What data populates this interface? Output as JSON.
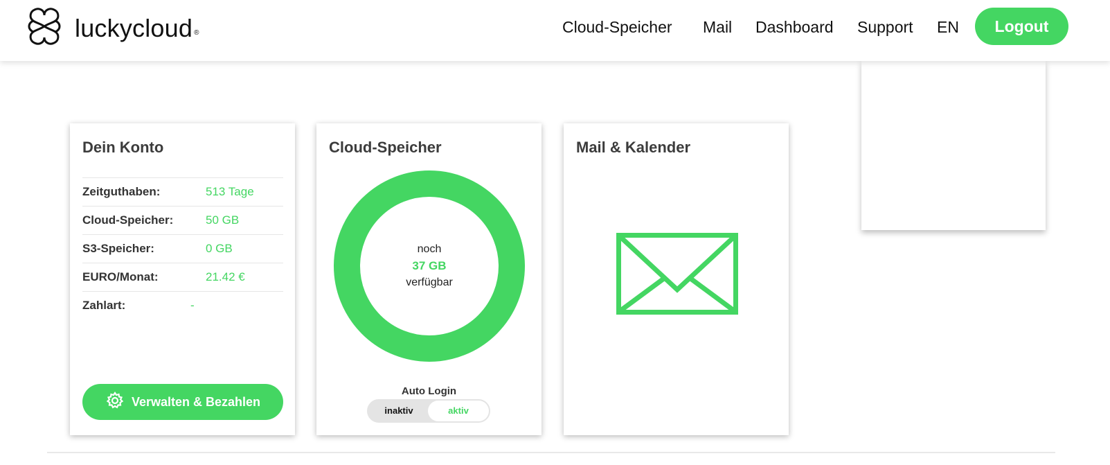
{
  "brand": {
    "name": "luckycloud",
    "reg": "®"
  },
  "nav": {
    "items": [
      "Cloud-Speicher",
      "Mail",
      "Dashboard",
      "Support",
      "EN"
    ],
    "logout_label": "Logout"
  },
  "account_card": {
    "title": "Dein Konto",
    "rows": [
      {
        "label": "Zeitguthaben:",
        "value": "513 Tage"
      },
      {
        "label": "Cloud-Speicher:",
        "value": "50 GB"
      },
      {
        "label": "S3-Speicher:",
        "value": "0 GB"
      },
      {
        "label": "EURO/Monat:",
        "value": "21.42 €"
      },
      {
        "label": "Zahlart:",
        "value": "-"
      }
    ],
    "button_label": "Verwalten & Bezahlen"
  },
  "storage_card": {
    "title": "Cloud-Speicher",
    "donut": {
      "line1": "noch",
      "amount": "37 GB",
      "line3": "verfügbar"
    },
    "auto_login": {
      "label": "Auto Login",
      "off_label": "inaktiv",
      "on_label": "aktiv",
      "state": "aktiv"
    }
  },
  "mail_card": {
    "title": "Mail & Kalender"
  },
  "colors": {
    "accent": "#44d662",
    "text_dark": "#3c3c3c",
    "toggle_bg": "#e4e4e4"
  },
  "icons": {
    "logo": "logo-icon",
    "gear": "gear-icon",
    "mail": "envelope-icon"
  }
}
